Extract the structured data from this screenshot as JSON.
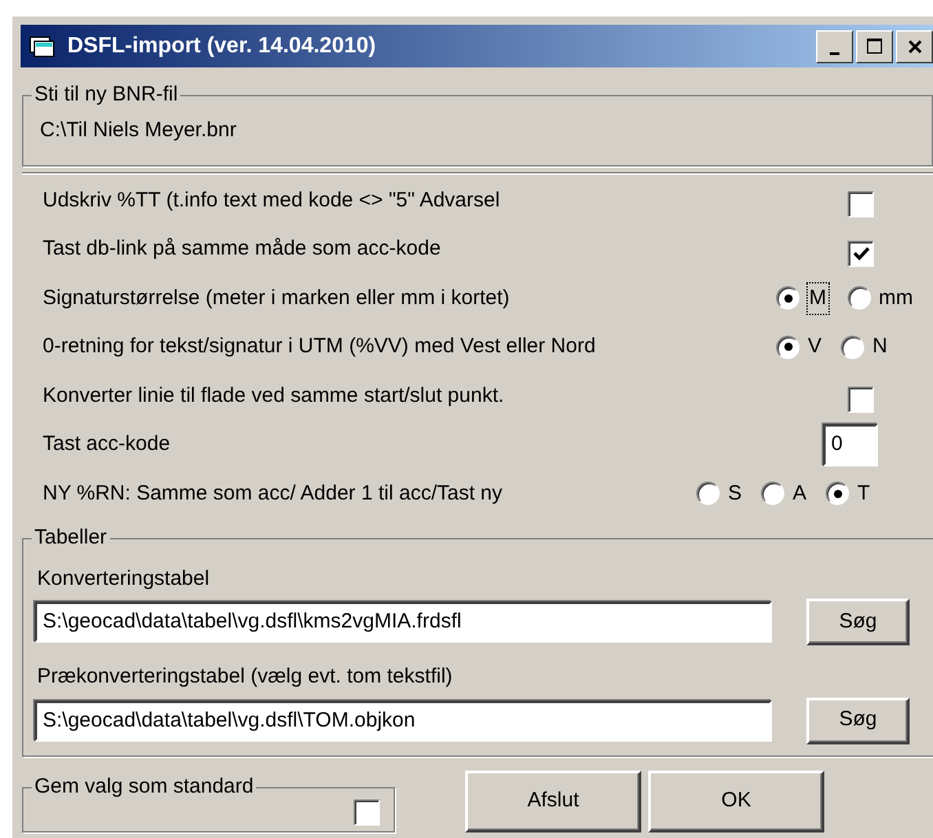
{
  "window": {
    "title": "DSFL-import (ver. 14.04.2010)"
  },
  "bnr_group": {
    "legend": "Sti til ny BNR-fil",
    "value": "C:\\Til Niels Meyer.bnr"
  },
  "options": [
    {
      "kind": "checkbox",
      "label": "Udskriv %TT (t.info text med kode <> \"5\" Advarsel",
      "checked": false
    },
    {
      "kind": "checkbox",
      "label": "Tast db-link på samme måde som acc-kode",
      "checked": true
    },
    {
      "kind": "radio",
      "label": "Signaturstørrelse (meter i marken eller mm i kortet)",
      "choices": [
        {
          "label": "M",
          "selected": true,
          "focused": true
        },
        {
          "label": "mm",
          "selected": false,
          "focused": false
        }
      ]
    },
    {
      "kind": "radio",
      "label": "0-retning for tekst/signatur i UTM (%VV) med Vest eller Nord",
      "choices": [
        {
          "label": "V",
          "selected": true,
          "focused": false
        },
        {
          "label": "N",
          "selected": false,
          "focused": false
        }
      ]
    },
    {
      "kind": "checkbox",
      "label": "Konverter linie til flade ved samme start/slut punkt.",
      "checked": false
    },
    {
      "kind": "number",
      "label": "Tast acc-kode",
      "value": "0"
    },
    {
      "kind": "radio",
      "label": "NY %RN: Samme som acc/ Adder 1 til acc/Tast ny",
      "choices": [
        {
          "label": "S",
          "selected": false,
          "focused": false
        },
        {
          "label": "A",
          "selected": false,
          "focused": false
        },
        {
          "label": "T",
          "selected": true,
          "focused": false
        }
      ]
    }
  ],
  "tables_group": {
    "legend": "Tabeller",
    "tables": [
      {
        "label": "Konverteringstabel",
        "value": "S:\\geocad\\data\\tabel\\vg.dsfl\\kms2vgMIA.frdsfl",
        "button": "Søg"
      },
      {
        "label": "Prækonverteringstabel (vælg evt. tom tekstfil)",
        "value": "S:\\geocad\\data\\tabel\\vg.dsfl\\TOM.objkon",
        "button": "Søg"
      }
    ]
  },
  "save_default": {
    "legend": "Gem valg som standard",
    "checked": false
  },
  "buttons": [
    "Afslut",
    "OK"
  ]
}
